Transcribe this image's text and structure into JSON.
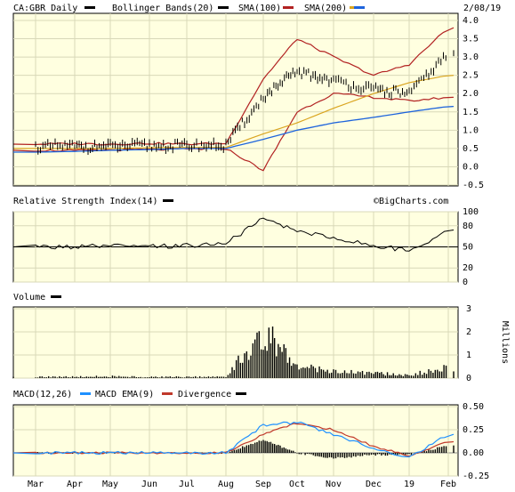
{
  "header": {
    "symbol": "CA:GBR Daily",
    "bollinger": "Bollinger Bands(20)",
    "sma100": "SMA(100)",
    "sma200": "SMA(200)",
    "date": "2/08/19"
  },
  "rsi_title": "Relative Strength Index(14)",
  "watermark": "©BigCharts.com",
  "volume_title": "Volume",
  "volume_unit": "Millions",
  "macd_titles": {
    "macd": "MACD(12,26)",
    "ema": "MACD EMA(9)",
    "div": "Divergence"
  },
  "colors": {
    "panel_bg": "#ffffe0",
    "price": "#000000",
    "bollinger": "#b22222",
    "sma100": "#daa520",
    "sma200": "#1e64dc",
    "macd": "#1e90ff",
    "macd_ema": "#c0392b"
  },
  "chart_data": [
    {
      "type": "line",
      "title": "CA:GBR Daily",
      "ylim": [
        -0.5,
        4.0
      ],
      "yticks": [
        "4.0",
        "3.5",
        "3.0",
        "2.5",
        "2.0",
        "1.5",
        "1.0",
        "0.5",
        "0.0",
        "-0.5"
      ],
      "x": [
        "Mar",
        "Apr",
        "May",
        "Jun",
        "Jul",
        "Aug",
        "Sep",
        "Oct",
        "Nov",
        "Dec",
        "19",
        "Feb"
      ],
      "series": [
        {
          "name": "CA:GBR Daily",
          "values": [
            0.55,
            0.55,
            0.56,
            0.57,
            0.58,
            0.59,
            1.9,
            2.6,
            2.35,
            2.1,
            2.0,
            3.1
          ]
        },
        {
          "name": "Bollinger Bands(20)",
          "upper": [
            0.62,
            0.63,
            0.62,
            0.64,
            0.62,
            0.64,
            2.4,
            3.5,
            3.0,
            2.5,
            2.8,
            3.8
          ],
          "lower": [
            0.45,
            0.44,
            0.46,
            0.47,
            0.48,
            0.5,
            -0.1,
            1.5,
            2.0,
            1.9,
            1.8,
            1.9
          ]
        },
        {
          "name": "SMA(100)",
          "values": [
            0.5,
            0.5,
            0.5,
            0.52,
            0.53,
            0.53,
            0.9,
            1.2,
            1.6,
            2.0,
            2.3,
            2.5
          ]
        },
        {
          "name": "SMA(200)",
          "values": [
            0.4,
            0.42,
            0.45,
            0.47,
            0.5,
            0.5,
            0.75,
            1.0,
            1.2,
            1.35,
            1.5,
            1.65
          ]
        }
      ]
    },
    {
      "type": "line",
      "title": "Relative Strength Index(14)",
      "ylim": [
        0,
        100
      ],
      "yticks": [
        "100",
        "80",
        "50",
        "20",
        "0"
      ],
      "series": [
        {
          "name": "Relative Strength Index(14)",
          "values": [
            50,
            50,
            51,
            50,
            52,
            55,
            90,
            73,
            63,
            52,
            44,
            74
          ]
        }
      ]
    },
    {
      "type": "bar",
      "title": "Volume",
      "ylabel": "Millions",
      "ylim": [
        0,
        3
      ],
      "yticks": [
        "3",
        "2",
        "1",
        "0"
      ],
      "x": [
        "Mar",
        "Apr",
        "May",
        "Jun",
        "Jul",
        "Aug",
        "Sep",
        "Oct",
        "Nov",
        "Dec",
        "19",
        "Feb"
      ],
      "values": [
        0.05,
        0.07,
        0.08,
        0.06,
        0.06,
        0.1,
        2.4,
        0.6,
        0.35,
        0.25,
        0.15,
        0.5
      ]
    },
    {
      "type": "line",
      "title": "MACD(12,26)",
      "ylim": [
        -0.15,
        0.5
      ],
      "yticks": [
        "0.50",
        "0.25",
        "0.00",
        "-0.25"
      ],
      "series": [
        {
          "name": "MACD(12,26)",
          "values": [
            0.0,
            0.0,
            0.0,
            0.0,
            0.0,
            0.0,
            0.3,
            0.33,
            0.2,
            0.05,
            -0.05,
            0.2
          ]
        },
        {
          "name": "MACD EMA(9)",
          "values": [
            0.0,
            0.0,
            0.0,
            0.0,
            0.0,
            0.0,
            0.2,
            0.32,
            0.25,
            0.07,
            -0.03,
            0.12
          ]
        },
        {
          "name": "Divergence",
          "values": [
            0.0,
            0.0,
            0.0,
            0.0,
            0.0,
            0.0,
            0.14,
            0.0,
            -0.06,
            -0.02,
            -0.02,
            0.08
          ]
        }
      ]
    }
  ]
}
